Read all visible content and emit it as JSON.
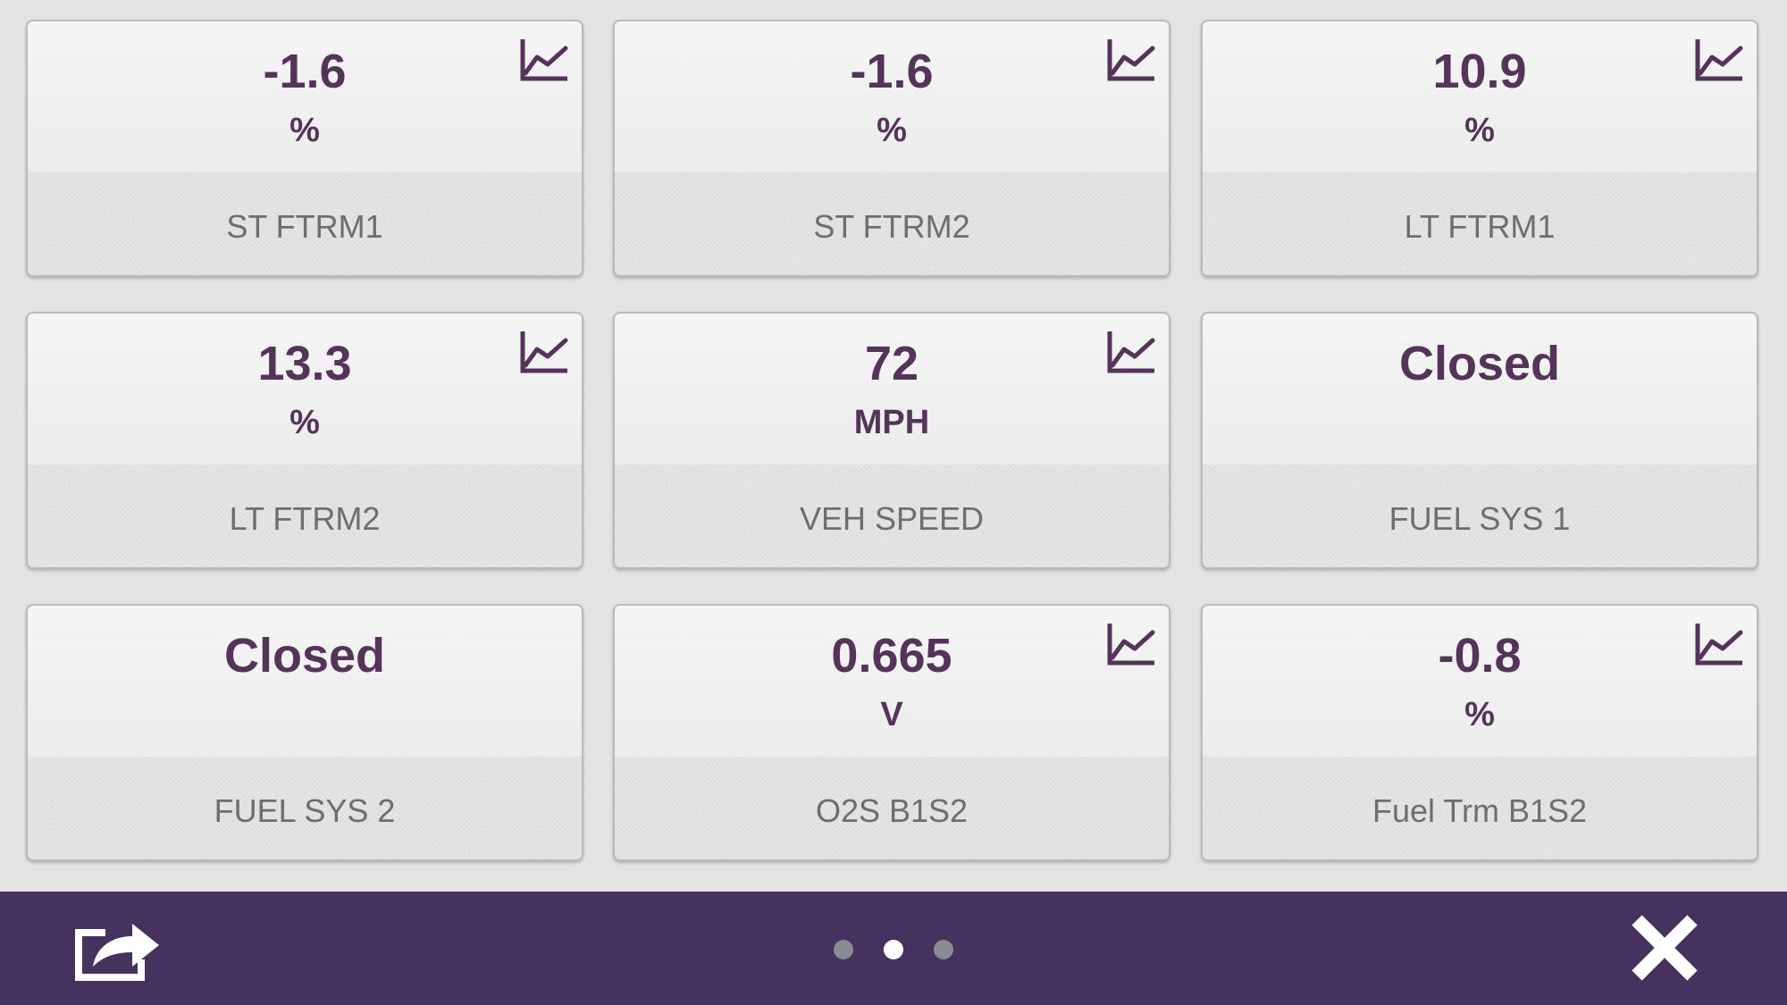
{
  "tiles": [
    {
      "value": "-1.6",
      "unit": "%",
      "label": "ST FTRM1",
      "graph_icon": "line-chart-icon",
      "has_graph": true
    },
    {
      "value": "-1.6",
      "unit": "%",
      "label": "ST FTRM2",
      "graph_icon": "line-chart-icon",
      "has_graph": true
    },
    {
      "value": "10.9",
      "unit": "%",
      "label": "LT FTRM1",
      "graph_icon": "line-chart-icon",
      "has_graph": true
    },
    {
      "value": "13.3",
      "unit": "%",
      "label": "LT FTRM2",
      "graph_icon": "line-chart-icon",
      "has_graph": true
    },
    {
      "value": "72",
      "unit": "MPH",
      "label": "VEH SPEED",
      "graph_icon": "line-chart-icon",
      "has_graph": true
    },
    {
      "value": "Closed",
      "unit": "",
      "label": "FUEL SYS 1",
      "has_graph": false
    },
    {
      "value": "Closed",
      "unit": "",
      "label": "FUEL SYS 2",
      "has_graph": false
    },
    {
      "value": "0.665",
      "unit": "V",
      "label": "O2S B1S2",
      "graph_icon": "line-chart-icon",
      "has_graph": true
    },
    {
      "value": "-0.8",
      "unit": "%",
      "label": "Fuel Trm B1S2",
      "graph_icon": "line-chart-icon",
      "has_graph": true
    }
  ],
  "footer": {
    "share_icon": "share-icon",
    "close_icon": "close-icon",
    "pages": 3,
    "current_page": 2
  },
  "colors": {
    "accent": "#55345a",
    "footer_bg": "#45325e",
    "label": "#6e6e6e",
    "page_bg": "#e3e3e3"
  }
}
